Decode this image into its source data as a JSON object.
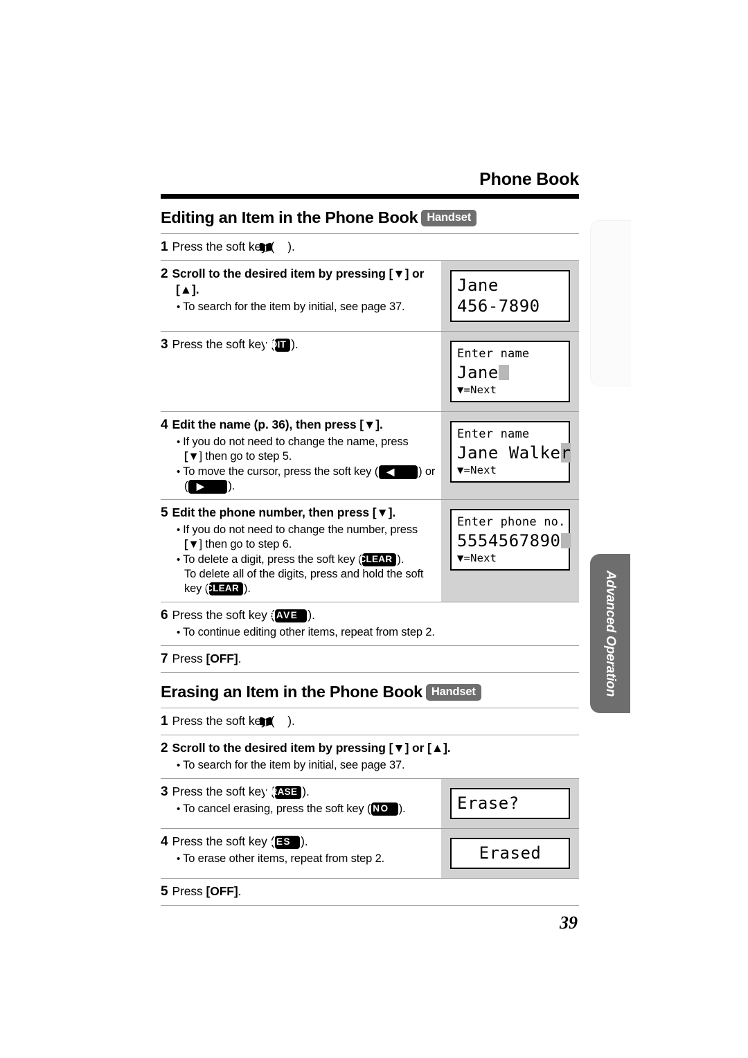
{
  "page": {
    "running_head": "Phone Book",
    "page_number": "39",
    "side_tab_label": "Advanced Operation"
  },
  "icons": {
    "phonebook": "phonebook-book-icon",
    "left_arrow": "◀",
    "right_arrow": "▶",
    "down_arrow": "▼",
    "up_arrow": "▲"
  },
  "sections": [
    {
      "title": "Editing an Item in the Phone Book",
      "badge": "Handset",
      "steps": [
        {
          "num": "1",
          "text_parts": [
            {
              "t": "Press the soft key (",
              "style": "plain"
            },
            {
              "t": "phonebook-icon",
              "style": "icon"
            },
            {
              "t": ").",
              "style": "plain"
            }
          ],
          "plain_text": "Press the soft key (☆).",
          "bullets": [],
          "lcd": null,
          "lcd_cell": "plain"
        },
        {
          "num": "2",
          "plain_text": "Scroll to the desired item by pressing [▼] or [▲].",
          "bullets": [
            "To search for the item by initial, see page 37."
          ],
          "lcd": {
            "lines": [
              {
                "text": "Jane",
                "size": "big"
              },
              {
                "text": "456-7890",
                "size": "big"
              }
            ]
          },
          "lcd_cell": "gray"
        },
        {
          "num": "3",
          "plain_text": "Press the soft key (EDIT).",
          "key": "EDIT",
          "bullets": [],
          "lcd": {
            "lines": [
              {
                "text": "Enter name",
                "size": "normal"
              },
              {
                "text": "Jane",
                "size": "big",
                "cursor": true
              },
              {
                "text": "▼=Next",
                "size": "small"
              }
            ]
          },
          "lcd_cell": "gray"
        },
        {
          "num": "4",
          "plain_text": "Edit the name (p. 36), then press [▼].",
          "bullets": [
            "If you do not need to change the name, press [▼] then go to step 5.",
            "To move the cursor, press the soft key (◀) or (▶)."
          ],
          "lcd": {
            "lines": [
              {
                "text": "Enter name",
                "size": "normal"
              },
              {
                "text": "Jane Walke",
                "tail": "r",
                "size": "big",
                "highlight_tail": true
              },
              {
                "text": "▼=Next",
                "size": "small"
              }
            ]
          },
          "lcd_cell": "gray"
        },
        {
          "num": "5",
          "plain_text": "Edit the phone number, then press [▼].",
          "bullets": [
            "If you do not need to change the number, press [▼] then go to step 6.",
            "To delete a digit, press the soft key (CLEAR). To delete all of the digits, press and hold the soft key (CLEAR)."
          ],
          "lcd": {
            "lines": [
              {
                "text": "Enter phone no.",
                "size": "normal"
              },
              {
                "text": "5554567890",
                "size": "big",
                "cursor": true
              },
              {
                "text": "▼=Next",
                "size": "small"
              }
            ]
          },
          "lcd_cell": "gray"
        },
        {
          "num": "6",
          "plain_text": "Press the soft key (SAVE).",
          "key": "SAVE",
          "bullets": [
            "To continue editing other items, repeat from step 2."
          ],
          "lcd": null,
          "lcd_cell": "plain"
        },
        {
          "num": "7",
          "plain_text": "Press [OFF].",
          "bullets": [],
          "lcd": null,
          "lcd_cell": "plain"
        }
      ]
    },
    {
      "title": "Erasing an Item in the Phone Book",
      "badge": "Handset",
      "steps": [
        {
          "num": "1",
          "plain_text": "Press the soft key (☆).",
          "bullets": [],
          "lcd": null,
          "lcd_cell": "plain"
        },
        {
          "num": "2",
          "plain_text": "Scroll to the desired item by pressing [▼] or [▲].",
          "bullets": [
            "To search for the item by initial, see page 37."
          ],
          "lcd": null,
          "lcd_cell": "plain"
        },
        {
          "num": "3",
          "plain_text": "Press the soft key (ERASE).",
          "key": "ERASE",
          "bullets": [
            "To cancel erasing, press the soft key (NO)."
          ],
          "lcd": {
            "lines": [
              {
                "text": "Erase?",
                "size": "big"
              }
            ]
          },
          "lcd_cell": "gray"
        },
        {
          "num": "4",
          "plain_text": "Press the soft key (YES).",
          "key": "YES",
          "bullets": [
            "To erase other items, repeat from step 2."
          ],
          "lcd": {
            "lines": [
              {
                "text": "Erased",
                "size": "big",
                "align": "center"
              }
            ]
          },
          "lcd_cell": "gray"
        },
        {
          "num": "5",
          "plain_text": "Press [OFF].",
          "bullets": [],
          "lcd": null,
          "lcd_cell": "plain"
        }
      ]
    }
  ],
  "text": {
    "press_the_soft_key": "Press the soft key (",
    "close_paren_period": ").",
    "scroll_line_a": "Scroll to the desired item by pressing [",
    "scroll_line_b": "] or [",
    "scroll_line_c": "].",
    "search_bullet": "To search for the item by initial, see page 37.",
    "edit_name_a": "Edit the name (p. 36), then press [",
    "edit_name_b": "].",
    "no_change_name_a": "If you do not need to change the name, press",
    "no_change_name_b": "] then go to step 5.",
    "move_cursor_a": "To move the cursor, press the soft key (",
    "move_cursor_b": ") or",
    "move_cursor_c": ").",
    "edit_number_a": "Edit the phone number, then press [",
    "edit_number_b": "].",
    "no_change_number_a": "If you do not need to change the number, press",
    "no_change_number_b": "] then go to step 6.",
    "delete_digit_a": "To delete a digit, press the soft key (",
    "delete_digit_b": ").",
    "delete_all_a": "To delete all of the digits, press and hold the soft",
    "delete_all_b": "key (",
    "delete_all_c": ").",
    "continue_editing": "To continue editing other items, repeat from step 2.",
    "press_off_a": "Press ",
    "press_off_b": "[OFF]",
    "press_off_c": ".",
    "cancel_erasing_a": "To cancel erasing, press the soft key (",
    "cancel_erasing_b": ").",
    "erase_others": "To erase other items, repeat from step 2.",
    "key_edit": "EDIT",
    "key_save": "SAVE",
    "key_clear": "CLEAR",
    "key_erase": "ERASE",
    "key_no": "NO",
    "key_yes": "YES"
  },
  "colors": {
    "badge_gray": "#6e6e6e",
    "lcd_column_gray": "#d2d2d2",
    "rule_gray": "#9a9a9a",
    "key_black": "#000000",
    "cursor_gray": "#b8b8b8"
  }
}
